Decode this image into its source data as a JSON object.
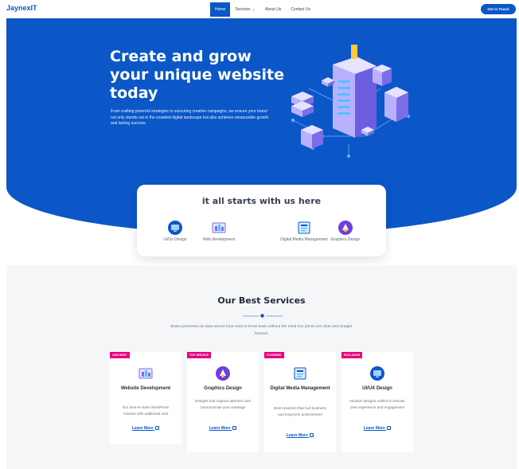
{
  "header": {
    "logo": "JaynexIT",
    "nav": [
      {
        "label": "Home",
        "active": true
      },
      {
        "label": "Services",
        "active": false,
        "dropdown": true
      },
      {
        "label": "About Us",
        "active": false
      },
      {
        "label": "Contact Us",
        "active": false
      }
    ],
    "cta": "Get in Touch"
  },
  "hero": {
    "title": "Create and grow your unique website today",
    "description": "From crafting powerful strategies to executing creative campaigns, we ensure your brand not only stands out in the crowded digital landscape but also achieves measurable growth and lasting success."
  },
  "intro_card": {
    "title": "it all starts with us here",
    "items": [
      {
        "label": "Ui/Ux Design",
        "icon": "ux-design-icon"
      },
      {
        "label": "Web development",
        "icon": "web-development-icon"
      },
      {
        "label": "Digital Media Management",
        "icon": "digital-media-icon"
      },
      {
        "label": "Graphics Design",
        "icon": "graphics-design-icon"
      }
    ]
  },
  "services": {
    "title": "Our Best Services",
    "subtitle": "Share processes an data secure lona need to know basis without the need Our prices are clear and straight forward",
    "cards": [
      {
        "badge": "OUR BEST",
        "name": "Website Development",
        "description": "Our best-in-class WordPress solution with additional viral",
        "link": "Learn More",
        "icon": "website-development-icon"
      },
      {
        "badge": "TOP SERVICE",
        "name": "Graphics Design",
        "description": "Designs that capture attention and communicate your message",
        "link": "Learn More",
        "icon": "graphics-design-icon"
      },
      {
        "badge": "POWERED",
        "name": "Digital Media Management",
        "description": "Best solutions that fuel business and long-term achievement",
        "link": "Learn More",
        "icon": "digital-media-icon"
      },
      {
        "badge": "EXCLUSIVE",
        "name": "UI/UX Design",
        "description": "Intuitive designs crafted to elevate user experience and engagement",
        "link": "Learn More",
        "icon": "ux-design-icon"
      }
    ]
  },
  "colors": {
    "primary": "#0b57c7",
    "badge": "#e6007e",
    "section_bg": "#f5f6f8"
  }
}
